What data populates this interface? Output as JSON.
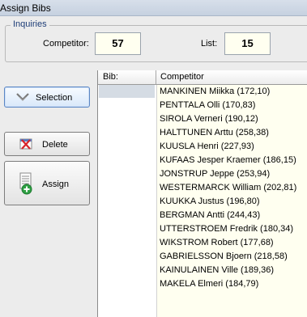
{
  "window": {
    "title": "Assign Bibs"
  },
  "inquiries": {
    "legend": "Inquiries",
    "competitor_label": "Competitor:",
    "competitor_value": "57",
    "list_label": "List:",
    "list_value": "15"
  },
  "buttons": {
    "selection": "Selection",
    "delete": "Delete",
    "assign": "Assign"
  },
  "grid": {
    "columns": [
      "Bib:",
      "Competitor"
    ],
    "rows": [
      "MANKINEN Miikka (172,10)",
      "PENTTALA Olli (170,83)",
      "SIROLA Verneri (190,12)",
      "HALTTUNEN Arttu (258,38)",
      "KUUSLA Henri (227,93)",
      "KUFAAS Jesper Kraemer (186,15)",
      "JONSTRUP Jeppe (253,94)",
      "WESTERMARCK William (202,81)",
      "KUUKKA Justus (196,80)",
      "BERGMAN Antti (244,43)",
      "UTTERSTROEM Fredrik (180,34)",
      "WIKSTROM Robert (177,68)",
      "GABRIELSSON Bjoern (218,58)",
      "KAINULAINEN Ville (189,36)",
      "MAKELA Elmeri (184,79)"
    ]
  },
  "icons": {
    "selection": "chevron-down-icon",
    "delete": "delete-x-icon",
    "assign": "assign-document-icon"
  }
}
